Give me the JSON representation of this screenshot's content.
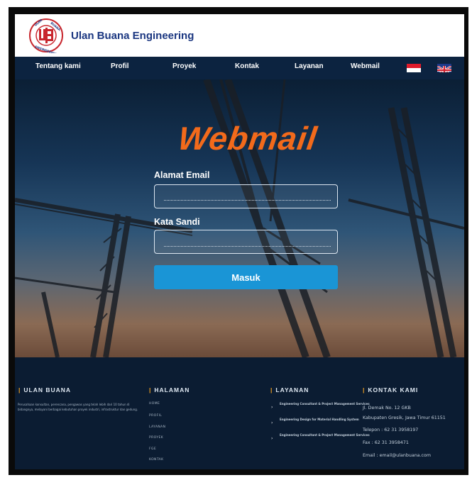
{
  "header": {
    "brand": "Ulan Buana Engineering",
    "logo_letters": "UBE",
    "logo_ring_text": "ULAN BUANA ENGINEERING"
  },
  "nav": {
    "items": [
      "Tentang kami",
      "Profil",
      "Proyek",
      "Kontak",
      "Layanan",
      "Webmail"
    ]
  },
  "hero": {
    "title": "Webmail",
    "email_label": "Alamat Email",
    "email_value": "",
    "password_label": "Kata Sandi",
    "password_value": "",
    "submit_label": "Masuk"
  },
  "footer": {
    "about_title": "ULAN BUANA",
    "about_text": "Perusahaan konsultan, perencana, pengawas yang telah lebih dari 10 tahun di bidangnya, melayani berbagai kebutuhan proyek industri, infrastruktur dan gedung.",
    "pages_title": "HALAMAN",
    "pages": [
      "HOME",
      "PROFIL",
      "LAYANAN",
      "PROYEK",
      "FGE",
      "KONTAK"
    ],
    "services_title": "LAYANAN",
    "services": [
      "Engineering Consultant & Project Management Services",
      "Engineering Design for Material Handling System",
      "Engineering Consultant & Project Management Services"
    ],
    "contact_title": "KONTAK KAMI",
    "contact": [
      "Jl. Demak No. 12 GKB",
      "Kabupaten Gresik, Jawa Timur 61151",
      "Telepon : 62 31 3958197",
      "Fax : 62 31 3958471",
      "Email : email@ulanbuana.com"
    ]
  },
  "colors": {
    "brand_blue": "#1a3680",
    "nav_bg": "#0c2340",
    "webmail_orange": "#f26a1b",
    "button_blue": "#1a95d6",
    "footer_bg": "#0b1c32",
    "footer_accent": "#f2a020"
  },
  "icons": [
    "ube-logo-icon",
    "indonesia-flag-icon",
    "uk-flag-icon",
    "chevron-right-icon"
  ]
}
